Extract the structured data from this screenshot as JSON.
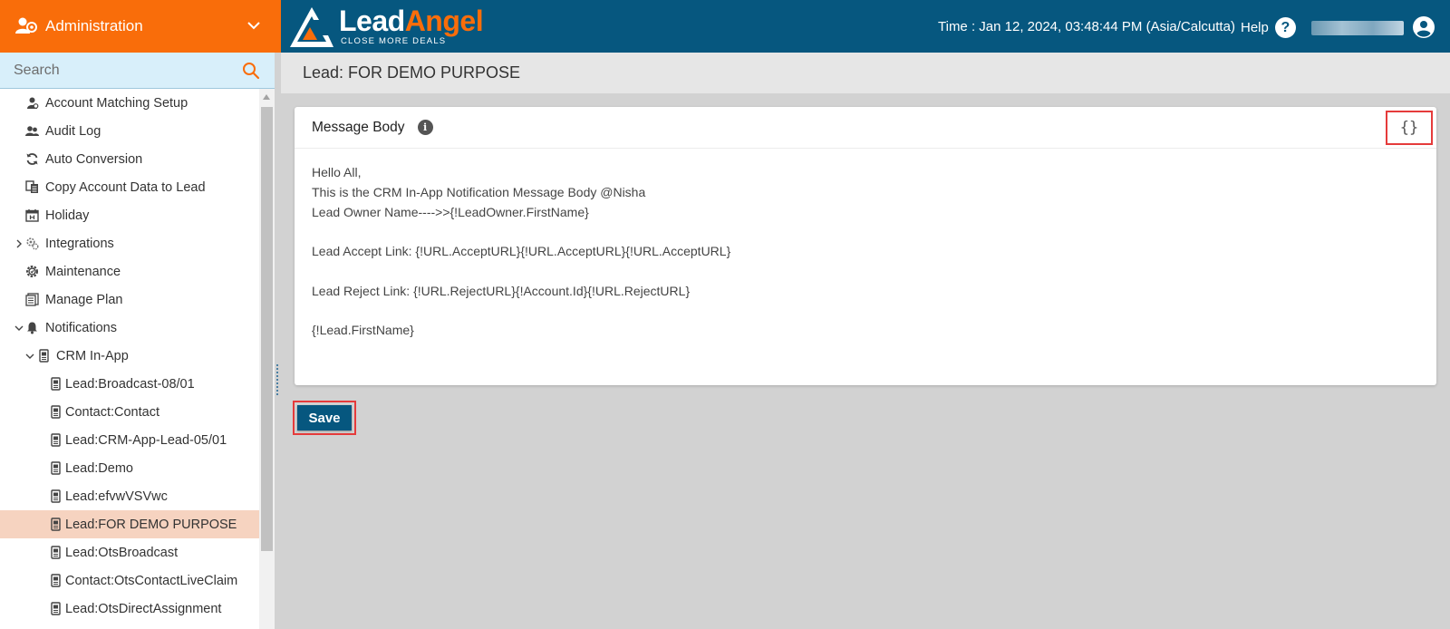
{
  "topbar": {
    "admin_label": "Administration",
    "logo": {
      "lead": "Lead",
      "angel": "Angel",
      "tagline": "CLOSE MORE DEALS"
    },
    "time": "Time : Jan 12, 2024, 03:48:44 PM (Asia/Calcutta)",
    "help_label": "Help",
    "help_icon": "?",
    "colors": {
      "bar": "#06577f",
      "admin": "#f96d0a"
    }
  },
  "sidebar": {
    "search_placeholder": "Search",
    "items": [
      {
        "label": "Account Matching Setup",
        "icon": "account-matching-icon",
        "level": 0
      },
      {
        "label": "Audit Log",
        "icon": "users-icon",
        "level": 0
      },
      {
        "label": "Auto Conversion",
        "icon": "sync-icon",
        "level": 0
      },
      {
        "label": "Copy Account Data to Lead",
        "icon": "copy-data-icon",
        "level": 0
      },
      {
        "label": "Holiday",
        "icon": "calendar-icon",
        "level": 0
      },
      {
        "label": "Integrations",
        "icon": "gears-icon",
        "level": 0,
        "expander": "collapsed"
      },
      {
        "label": "Maintenance",
        "icon": "maintenance-gear-icon",
        "level": 0
      },
      {
        "label": "Manage Plan",
        "icon": "plan-icon",
        "level": 0
      },
      {
        "label": "Notifications",
        "icon": "bell-icon",
        "level": 0,
        "expander": "expanded"
      },
      {
        "label": "CRM In-App",
        "icon": "device-icon",
        "level": 1,
        "expander": "expanded"
      },
      {
        "label": "Lead:Broadcast-08/01",
        "icon": "device-icon",
        "level": 2
      },
      {
        "label": "Contact:Contact",
        "icon": "device-icon",
        "level": 2
      },
      {
        "label": "Lead:CRM-App-Lead-05/01",
        "icon": "device-icon",
        "level": 2
      },
      {
        "label": "Lead:Demo",
        "icon": "device-icon",
        "level": 2
      },
      {
        "label": "Lead:efvwVSVwc",
        "icon": "device-icon",
        "level": 2
      },
      {
        "label": "Lead:FOR DEMO PURPOSE",
        "icon": "device-icon",
        "level": 2,
        "selected": true
      },
      {
        "label": "Lead:OtsBroadcast",
        "icon": "device-icon",
        "level": 2
      },
      {
        "label": "Contact:OtsContactLiveClaim",
        "icon": "device-icon",
        "level": 2
      },
      {
        "label": "Lead:OtsDirectAssignment",
        "icon": "device-icon",
        "level": 2
      }
    ],
    "selected_color": "#f6d3c0"
  },
  "main": {
    "page_title": "Lead: FOR DEMO PURPOSE",
    "card": {
      "title": "Message Body",
      "info_icon": "i",
      "merge_field_label": "{}",
      "body_lines": [
        "Hello All,",
        "This is the CRM In-App Notification Message Body @Nisha",
        "Lead Owner Name---->>{!LeadOwner.FirstName}",
        "",
        "Lead Accept Link: {!URL.AcceptURL}{!URL.AcceptURL}{!URL.AcceptURL}",
        "",
        "Lead Reject Link: {!URL.RejectURL}{!Account.Id}{!URL.RejectURL}",
        "",
        "{!Lead.FirstName}"
      ]
    },
    "save_label": "Save",
    "highlight_color": "#e53b3b"
  }
}
